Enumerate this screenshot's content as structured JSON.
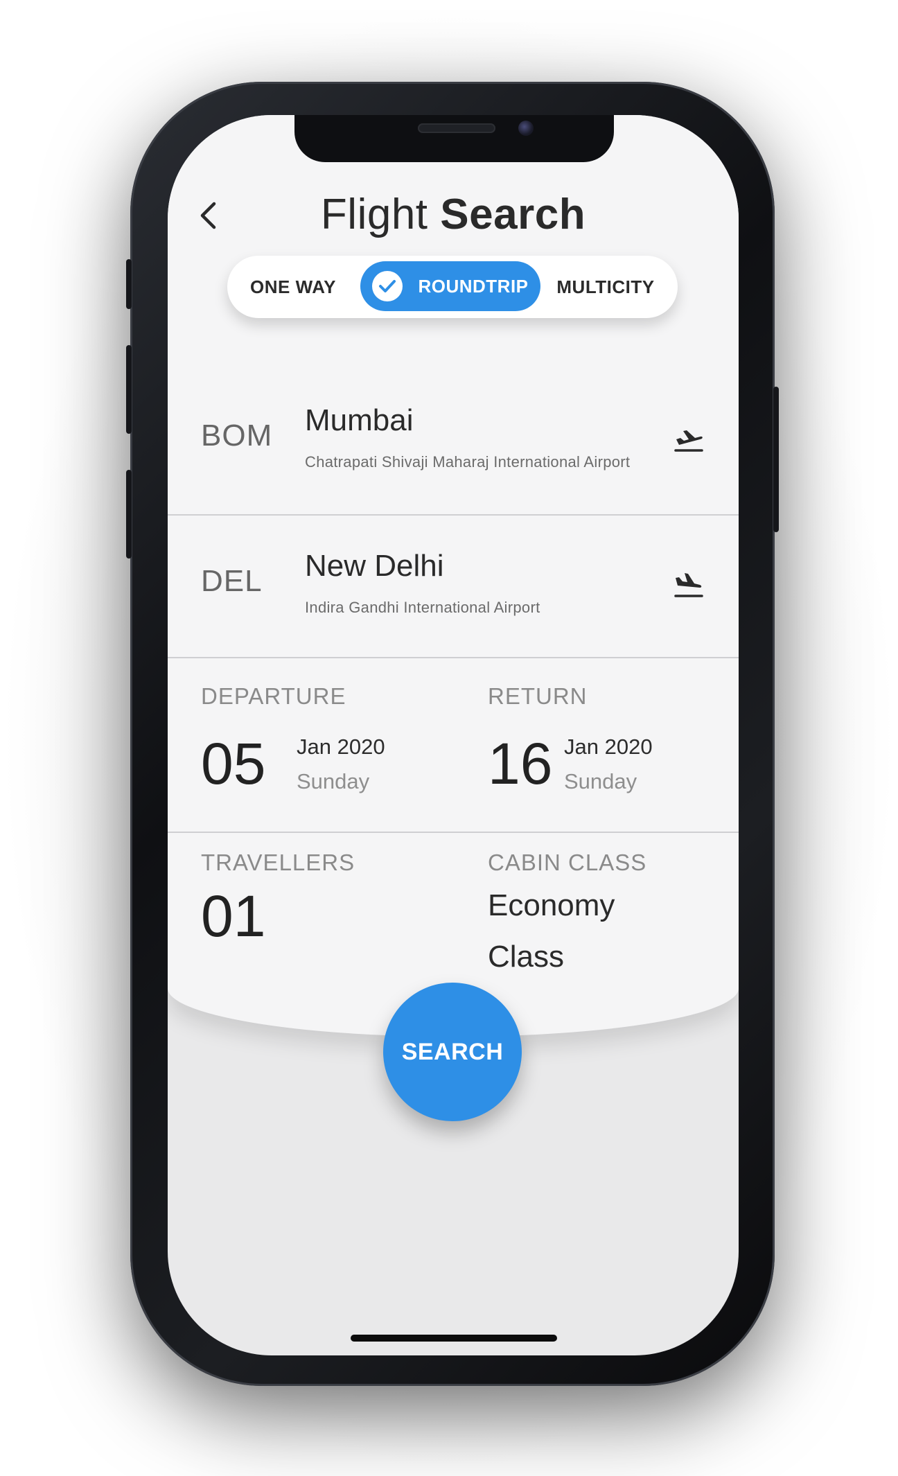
{
  "header": {
    "title_light": "Flight",
    "title_bold": "Search"
  },
  "trip_type": {
    "options": [
      "ONE WAY",
      "ROUNDTRIP",
      "MULTICITY"
    ],
    "selected": "ROUNDTRIP"
  },
  "origin": {
    "code": "BOM",
    "city": "Mumbai",
    "airport": "Chatrapati Shivaji Maharaj International Airport",
    "icon": "plane-takeoff-icon"
  },
  "destination": {
    "code": "DEL",
    "city": "New Delhi",
    "airport": "Indira Gandhi International Airport",
    "icon": "plane-landing-icon"
  },
  "departure": {
    "label": "DEPARTURE",
    "day": "05",
    "month_year": "Jan 2020",
    "weekday": "Sunday"
  },
  "return": {
    "label": "RETURN",
    "day": "16",
    "month_year": "Jan 2020",
    "weekday": "Sunday"
  },
  "travellers": {
    "label": "TRAVELLERS",
    "value": "01"
  },
  "cabin_class": {
    "label": "CABIN CLASS",
    "value": "Economy Class"
  },
  "search_button": {
    "label": "SEARCH"
  },
  "colors": {
    "accent": "#2e8fe6",
    "card": "#f5f5f6",
    "background": "#e9e9ea"
  }
}
